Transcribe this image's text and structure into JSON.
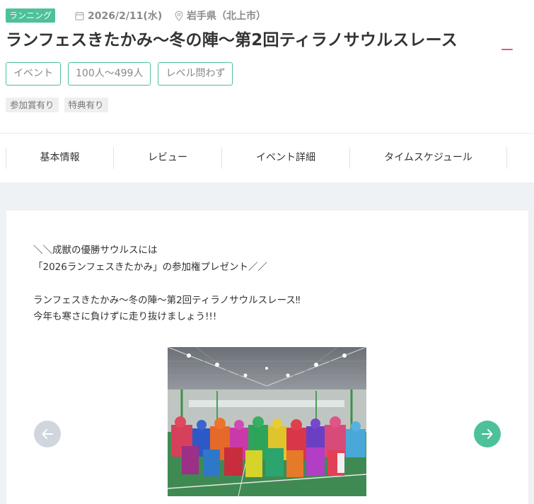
{
  "header": {
    "category": "ランニング",
    "date": "2026/2/11(水)",
    "location": "岩手県（北上市）",
    "title": "ランフェスきたかみ～冬の陣～第2回ティラノサウルスレース",
    "tags": [
      "イベント",
      "100人～499人",
      "レベル問わず"
    ],
    "chips": [
      "参加賞有り",
      "特典有り"
    ]
  },
  "tabs": [
    "基本情報",
    "レビュー",
    "イベント詳細",
    "タイムスケジュール"
  ],
  "description": {
    "lines": [
      "＼＼成獣の優勝サウルスには",
      "「2026ランフェスきたかみ」の参加権プレゼント／／",
      "",
      "ランフェスきたかみ～冬の陣～第2回ティラノサウルスレース‼",
      "今年も寒さに負けずに走り抜けましょう!!!"
    ]
  },
  "carousel": {
    "prev_icon": "arrow-left-icon",
    "next_icon": "arrow-right-icon",
    "image": "gymnasium-group-photo-dinosaur-costumes"
  },
  "colors": {
    "accent": "#4cc19a",
    "pink": "#e8558a",
    "gray_background": "#eff2f4",
    "prev_button": "#cfd6dd"
  }
}
